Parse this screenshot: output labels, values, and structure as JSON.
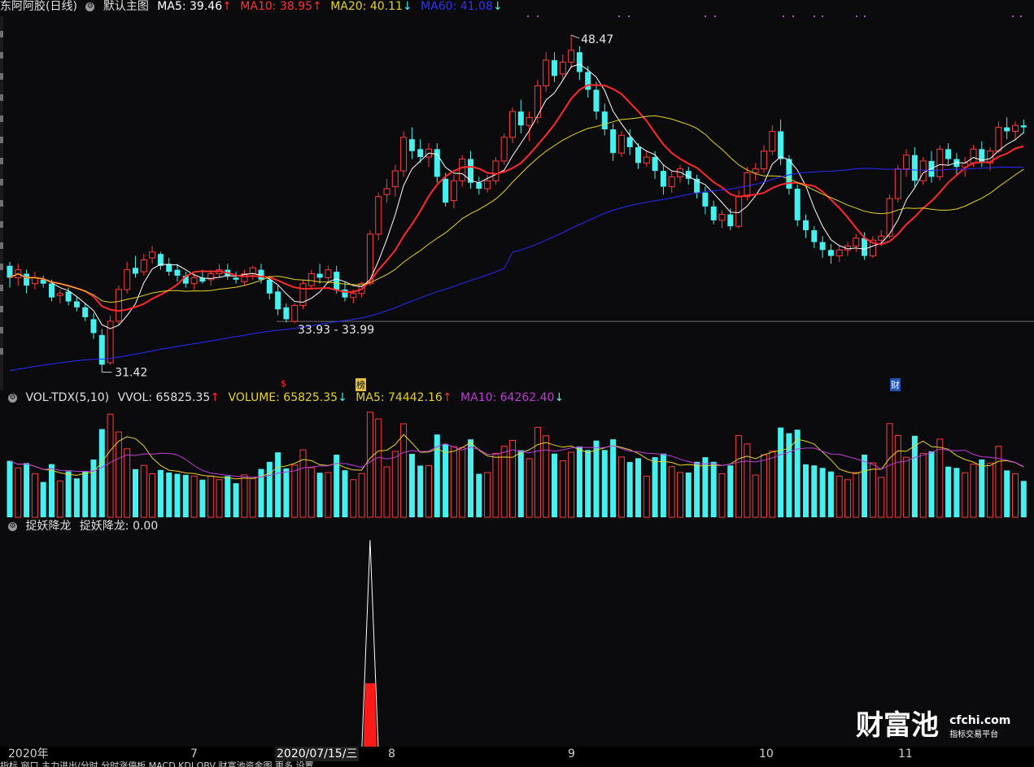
{
  "main_header": {
    "stock_name": "东阿阿胶(日线)",
    "chart_mode": "默认主图",
    "ma5": "MA5: 39.46",
    "ma10": "MA10: 38.95",
    "ma20": "MA20: 40.11",
    "ma60": "MA60: 41.08",
    "colors": {
      "ma5": "#ffffff",
      "ma10": "#ff2a2a",
      "ma20": "#e6d428",
      "ma60": "#2b2bff"
    }
  },
  "price_annotations": {
    "high_label": "48.47",
    "low_label": "31.42",
    "range_label": "33.93 - 33.99"
  },
  "event_markers": [
    "$",
    "榜",
    "财"
  ],
  "volume_header": {
    "indicator": "VOL-TDX(5,10)",
    "vvol": "VVOL: 65825.35",
    "volume": "VOLUME: 65825.35",
    "ma5": "MA5: 74442.16",
    "ma10": "MA10: 64262.40"
  },
  "indicator_header": {
    "name": "捉妖降龙",
    "value": "捉妖降龙: 0.00"
  },
  "x_axis": {
    "labels": [
      "2020年",
      "7",
      "2020/07/15/三",
      "8",
      "9",
      "10",
      "11"
    ]
  },
  "bottom_tabs": "指标 窗口 主力进出/分时 分时涨停板 MACD KDJ OBV 财富池资金图 更多 设置",
  "watermark": {
    "brand": "财富池",
    "site": "cfchi.com",
    "tagline": "指标交易平台"
  },
  "chart_data": {
    "type": "candlestick",
    "title": "东阿阿胶(日线)",
    "ylim": [
      30.5,
      49.5
    ],
    "ohlc": [
      [
        36.8,
        37.0,
        35.7,
        36.2
      ],
      [
        36.2,
        36.9,
        35.8,
        36.6
      ],
      [
        36.4,
        36.6,
        35.4,
        35.8
      ],
      [
        35.9,
        36.5,
        35.6,
        36.2
      ],
      [
        36.1,
        36.3,
        35.7,
        35.9
      ],
      [
        35.9,
        36.1,
        35.0,
        35.2
      ],
      [
        35.3,
        35.6,
        34.9,
        35.4
      ],
      [
        35.5,
        35.7,
        34.8,
        35.0
      ],
      [
        35.0,
        35.2,
        34.5,
        34.7
      ],
      [
        34.7,
        34.9,
        34.0,
        34.2
      ],
      [
        34.1,
        34.4,
        33.1,
        33.4
      ],
      [
        33.3,
        33.6,
        31.42,
        31.8
      ],
      [
        31.9,
        34.3,
        31.8,
        34.0
      ],
      [
        34.0,
        35.8,
        33.8,
        35.6
      ],
      [
        35.6,
        37.0,
        35.4,
        36.6
      ],
      [
        36.7,
        37.3,
        36.2,
        36.4
      ],
      [
        36.5,
        37.4,
        36.3,
        37.1
      ],
      [
        37.2,
        37.8,
        36.9,
        37.5
      ],
      [
        37.4,
        37.5,
        36.6,
        36.8
      ],
      [
        36.9,
        37.2,
        36.3,
        36.5
      ],
      [
        36.6,
        36.9,
        36.0,
        36.3
      ],
      [
        36.3,
        36.5,
        35.7,
        35.9
      ],
      [
        35.9,
        36.4,
        35.6,
        36.2
      ],
      [
        36.2,
        36.6,
        35.9,
        36.0
      ],
      [
        36.1,
        36.6,
        35.8,
        36.4
      ],
      [
        36.4,
        36.9,
        36.2,
        36.6
      ],
      [
        36.6,
        36.9,
        36.1,
        36.3
      ],
      [
        36.2,
        36.5,
        35.9,
        36.1
      ],
      [
        36.0,
        36.6,
        35.8,
        36.4
      ],
      [
        36.4,
        36.8,
        36.1,
        36.7
      ],
      [
        36.6,
        36.9,
        35.9,
        36.1
      ],
      [
        36.1,
        36.3,
        35.1,
        35.4
      ],
      [
        35.5,
        35.8,
        34.3,
        34.6
      ],
      [
        34.7,
        34.9,
        33.93,
        34.1
      ],
      [
        33.99,
        34.9,
        33.9,
        34.8
      ],
      [
        34.8,
        36.1,
        34.6,
        35.9
      ],
      [
        35.8,
        36.6,
        35.6,
        36.4
      ],
      [
        36.4,
        36.9,
        35.9,
        36.2
      ],
      [
        36.2,
        36.8,
        35.9,
        36.6
      ],
      [
        36.5,
        36.8,
        35.4,
        35.6
      ],
      [
        35.6,
        36.0,
        35.0,
        35.2
      ],
      [
        35.2,
        35.6,
        34.9,
        35.4
      ],
      [
        35.4,
        36.0,
        35.2,
        35.9
      ],
      [
        35.9,
        38.6,
        35.8,
        38.4
      ],
      [
        38.4,
        40.5,
        38.1,
        40.3
      ],
      [
        40.4,
        41.2,
        40.0,
        40.7
      ],
      [
        40.8,
        41.9,
        40.3,
        41.6
      ],
      [
        41.6,
        43.6,
        41.3,
        43.3
      ],
      [
        43.2,
        43.8,
        42.2,
        42.6
      ],
      [
        42.7,
        43.2,
        42.0,
        42.3
      ],
      [
        42.3,
        43.0,
        41.8,
        42.7
      ],
      [
        42.7,
        43.0,
        41.0,
        41.3
      ],
      [
        41.2,
        41.5,
        39.8,
        40.0
      ],
      [
        40.1,
        41.4,
        39.7,
        41.1
      ],
      [
        41.1,
        42.4,
        40.8,
        42.2
      ],
      [
        42.2,
        42.6,
        40.7,
        41.0
      ],
      [
        41.0,
        41.3,
        40.4,
        40.7
      ],
      [
        40.7,
        41.4,
        40.5,
        41.1
      ],
      [
        41.1,
        42.3,
        40.9,
        42.1
      ],
      [
        42.1,
        43.5,
        41.9,
        43.3
      ],
      [
        43.3,
        44.8,
        43.0,
        44.6
      ],
      [
        44.6,
        45.2,
        43.5,
        43.9
      ],
      [
        43.9,
        44.6,
        43.1,
        44.3
      ],
      [
        44.3,
        46.2,
        44.0,
        45.9
      ],
      [
        45.9,
        47.6,
        45.6,
        47.2
      ],
      [
        47.2,
        47.6,
        46.1,
        46.4
      ],
      [
        46.5,
        47.5,
        46.2,
        47.1
      ],
      [
        47.1,
        48.47,
        46.8,
        47.7
      ],
      [
        47.6,
        47.9,
        46.2,
        46.6
      ],
      [
        46.6,
        46.9,
        45.3,
        45.7
      ],
      [
        45.7,
        46.1,
        44.2,
        44.6
      ],
      [
        44.6,
        45.0,
        43.4,
        43.7
      ],
      [
        43.7,
        44.0,
        42.1,
        42.5
      ],
      [
        42.5,
        43.6,
        42.3,
        43.4
      ],
      [
        43.3,
        43.7,
        42.4,
        42.8
      ],
      [
        42.8,
        43.0,
        41.7,
        42.0
      ],
      [
        42.0,
        42.6,
        41.8,
        42.3
      ],
      [
        42.3,
        42.6,
        41.2,
        41.6
      ],
      [
        41.6,
        41.9,
        40.4,
        40.8
      ],
      [
        40.8,
        41.6,
        40.5,
        41.3
      ],
      [
        41.3,
        41.9,
        41.0,
        41.7
      ],
      [
        41.6,
        41.8,
        40.9,
        41.2
      ],
      [
        41.2,
        41.4,
        40.2,
        40.5
      ],
      [
        40.5,
        40.8,
        39.4,
        39.8
      ],
      [
        39.8,
        40.1,
        38.9,
        39.1
      ],
      [
        39.1,
        39.6,
        38.7,
        39.4
      ],
      [
        39.4,
        39.7,
        38.6,
        38.8
      ],
      [
        38.8,
        40.6,
        38.7,
        40.3
      ],
      [
        40.3,
        41.8,
        40.1,
        41.5
      ],
      [
        41.5,
        42.0,
        41.1,
        41.7
      ],
      [
        41.7,
        42.9,
        41.5,
        42.6
      ],
      [
        42.6,
        43.9,
        42.4,
        43.6
      ],
      [
        43.6,
        44.2,
        41.9,
        42.2
      ],
      [
        42.2,
        42.4,
        40.4,
        40.7
      ],
      [
        40.7,
        40.9,
        38.8,
        39.1
      ],
      [
        39.1,
        39.4,
        38.2,
        38.6
      ],
      [
        38.6,
        38.8,
        37.7,
        38.0
      ],
      [
        38.0,
        38.3,
        37.2,
        37.6
      ],
      [
        37.6,
        37.9,
        36.9,
        37.3
      ],
      [
        37.3,
        37.8,
        37.0,
        37.6
      ],
      [
        37.6,
        38.0,
        37.3,
        37.8
      ],
      [
        37.8,
        38.4,
        37.5,
        38.2
      ],
      [
        38.2,
        38.5,
        37.1,
        37.3
      ],
      [
        37.3,
        38.3,
        37.2,
        38.1
      ],
      [
        38.1,
        38.6,
        37.8,
        38.3
      ],
      [
        38.3,
        40.4,
        38.2,
        40.2
      ],
      [
        40.2,
        41.9,
        40.0,
        41.7
      ],
      [
        41.7,
        42.7,
        41.3,
        42.4
      ],
      [
        42.4,
        42.8,
        40.8,
        41.1
      ],
      [
        41.1,
        42.3,
        40.9,
        42.1
      ],
      [
        42.1,
        42.6,
        41.0,
        41.3
      ],
      [
        41.3,
        42.9,
        41.1,
        42.7
      ],
      [
        42.7,
        43.0,
        41.9,
        42.2
      ],
      [
        42.2,
        42.5,
        41.4,
        41.8
      ],
      [
        41.8,
        42.3,
        41.3,
        42.0
      ],
      [
        42.0,
        42.9,
        41.8,
        42.7
      ],
      [
        42.7,
        43.1,
        41.8,
        42.0
      ],
      [
        42.0,
        42.8,
        41.6,
        42.6
      ],
      [
        42.6,
        44.1,
        42.5,
        43.8
      ],
      [
        43.8,
        44.3,
        43.2,
        43.6
      ],
      [
        43.6,
        44.1,
        43.2,
        43.9
      ],
      [
        43.9,
        44.2,
        43.5,
        43.8
      ]
    ]
  }
}
